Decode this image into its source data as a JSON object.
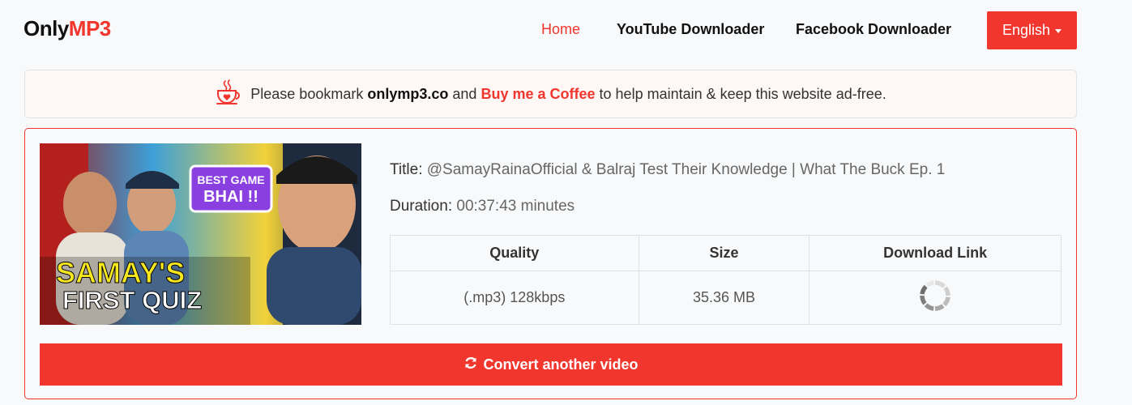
{
  "header": {
    "logo_part1": "Only",
    "logo_part2": "MP3",
    "nav": {
      "home": "Home",
      "youtube": "YouTube Downloader",
      "facebook": "Facebook Downloader"
    },
    "language": "English"
  },
  "notice": {
    "text1": "Please bookmark",
    "site": "onlymp3.co",
    "text2": "and",
    "coffee": "Buy me a Coffee",
    "text3": "to help maintain & keep this website ad-free.",
    "icon": "coffee-cup-heart-icon"
  },
  "result": {
    "thumbnail_text": {
      "bubble_line1": "BEST GAME",
      "bubble_line2": "BHAI !!",
      "title_line1": "SAMAY'S",
      "title_line2": "FIRST QUIZ"
    },
    "title_label": "Title:",
    "title": "@SamayRainaOfficial & Balraj Test Their Knowledge | What The Buck Ep. 1",
    "duration_label": "Duration:",
    "duration": "00:37:43 minutes",
    "table": {
      "headers": [
        "Quality",
        "Size",
        "Download Link"
      ],
      "rows": [
        {
          "quality": "(.mp3) 128kbps",
          "size": "35.36 MB",
          "link_icon": "loading-spinner-icon"
        }
      ]
    },
    "convert_label": "Convert another video",
    "convert_icon": "refresh-icon"
  },
  "colors": {
    "accent": "#f0362d",
    "background": "#f8f9fa"
  }
}
